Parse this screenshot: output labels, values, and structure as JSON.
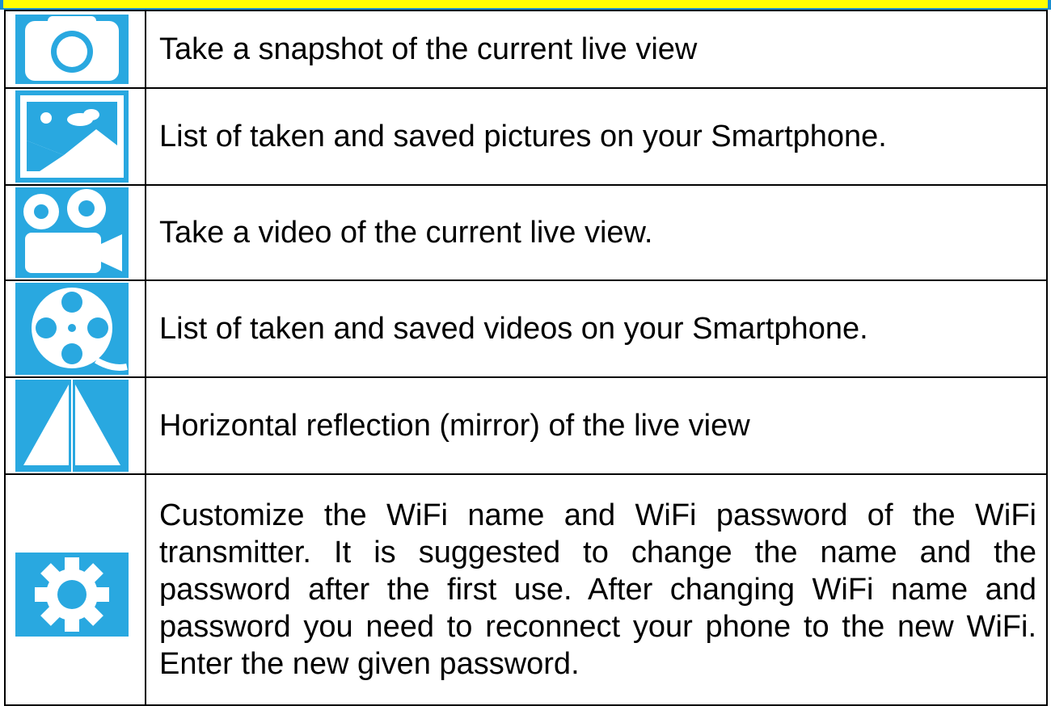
{
  "rows": [
    {
      "icon": "camera-icon",
      "text": "Take a snapshot of the current live view"
    },
    {
      "icon": "picture-gallery-icon",
      "text": "List of taken and saved pictures on your Smartphone."
    },
    {
      "icon": "video-camera-icon",
      "text": "Take a video of the current live view."
    },
    {
      "icon": "video-reel-icon",
      "text": "List of taken and saved videos on your Smartphone."
    },
    {
      "icon": "mirror-icon",
      "text": "Horizontal reflection (mirror) of the live view"
    },
    {
      "icon": "gear-icon",
      "text": "Customize the WiFi name and WiFi password of the WiFi transmitter. It is suggested to change the name and the password after the first use. After changing WiFi name and password you need to reconnect your phone to the new WiFi. Enter the new given password."
    }
  ],
  "colors": {
    "icon_blue": "#29a8e0",
    "icon_white": "#ffffff",
    "band_yellow": "#ffff00",
    "band_border": "#1a8fd0"
  }
}
